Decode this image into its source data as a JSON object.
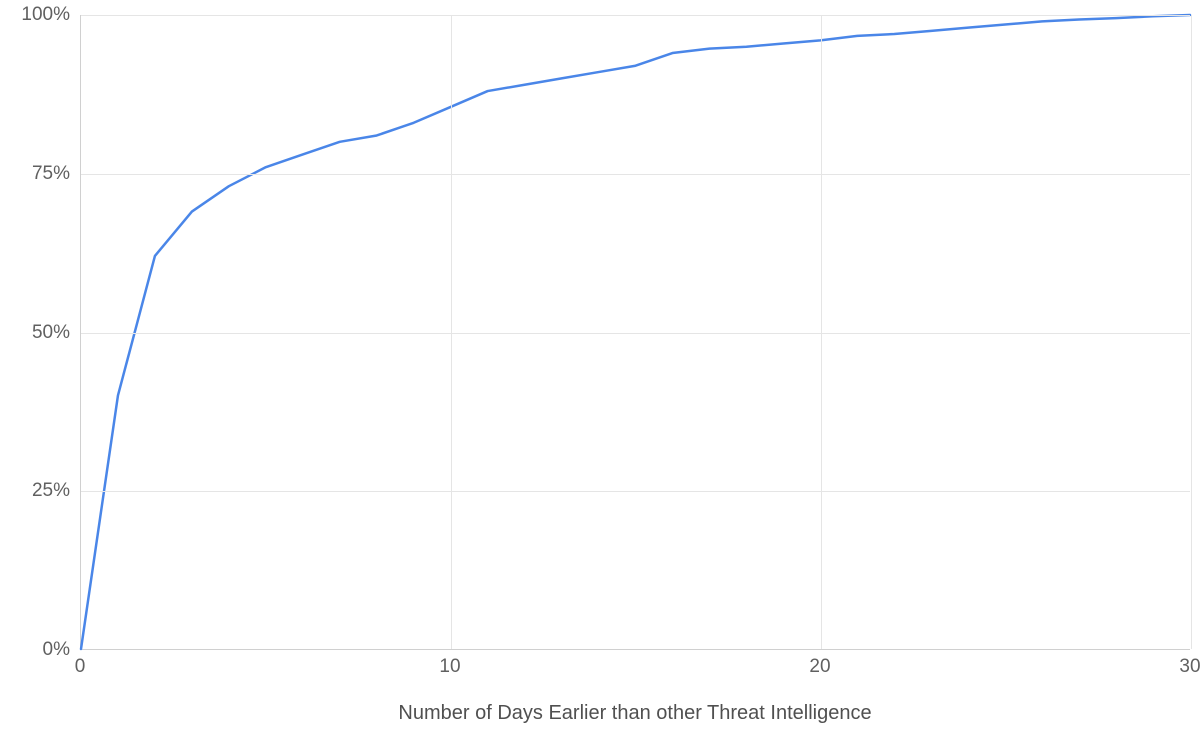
{
  "chart_data": {
    "type": "line",
    "x": [
      0,
      1,
      2,
      3,
      4,
      5,
      6,
      7,
      8,
      9,
      10,
      11,
      12,
      13,
      14,
      15,
      16,
      17,
      18,
      19,
      20,
      21,
      22,
      23,
      24,
      25,
      26,
      27,
      28,
      29,
      30
    ],
    "values": [
      0,
      40,
      62,
      69,
      73,
      76,
      78,
      80,
      81,
      83,
      85.5,
      88,
      89,
      90,
      91,
      92,
      94,
      94.7,
      95,
      95.5,
      96,
      96.7,
      97,
      97.5,
      98,
      98.5,
      99,
      99.3,
      99.5,
      99.8,
      100
    ],
    "xlabel": "Number of Days Earlier than other Threat Intelligence",
    "ylabel": "",
    "title": "",
    "y_ticks": [
      {
        "v": 0,
        "label": "0%"
      },
      {
        "v": 25,
        "label": "25%"
      },
      {
        "v": 50,
        "label": "50%"
      },
      {
        "v": 75,
        "label": "75%"
      },
      {
        "v": 100,
        "label": "100%"
      }
    ],
    "x_ticks": [
      {
        "v": 0,
        "label": "0"
      },
      {
        "v": 10,
        "label": "10"
      },
      {
        "v": 20,
        "label": "20"
      },
      {
        "v": 30,
        "label": "30"
      }
    ],
    "xlim": [
      0,
      30
    ],
    "ylim": [
      0,
      100
    ],
    "line_color": "#4a86e8"
  }
}
